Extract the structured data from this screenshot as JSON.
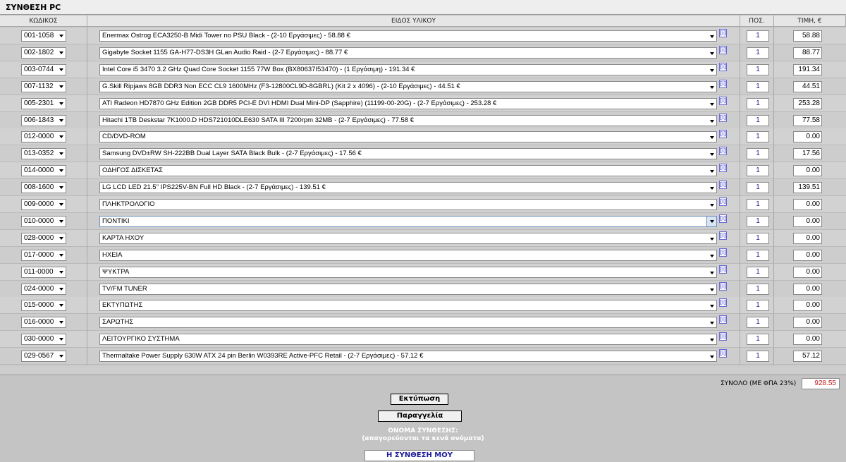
{
  "header": {
    "title": "ΣΥΝΘΕΣΗ PC"
  },
  "columns": {
    "code": "ΚΩΔΙΚΟΣ",
    "description": "ΕΙΔΟΣ ΥΛΙΚΟΥ",
    "qty": "ΠΟΣ.",
    "price": "ΤΙΜΗ, €"
  },
  "info_icon_text": "[i]",
  "rows": [
    {
      "code": "001-1058",
      "description": "Enermax Ostrog ECA3250-B Midi Tower no PSU Black - (2-10 Εργάσιμες) - 58.88 €",
      "qty": "1",
      "price": "58.88"
    },
    {
      "code": "002-1802",
      "description": "Gigabyte Socket 1155 GA-H77-DS3H GLan Audio Raid - (2-7 Εργάσιμες) - 88.77 €",
      "qty": "1",
      "price": "88.77"
    },
    {
      "code": "003-0744",
      "description": "Intel Core i5 3470 3.2 GHz Quad Core Socket 1155 77W Box (BX80637I53470) - (1 Εργάσιμη) - 191.34 €",
      "qty": "1",
      "price": "191.34"
    },
    {
      "code": "007-1132",
      "description": "G.Skill Ripjaws 8GB DDR3 Non ECC CL9 1600MHz (F3-12800CL9D-8GBRL) (Kit 2 x 4096) - (2-10 Εργάσιμες) - 44.51 €",
      "qty": "1",
      "price": "44.51"
    },
    {
      "code": "005-2301",
      "description": "ATI Radeon HD7870 GHz Edition 2GB DDR5 PCI-E DVI HDMI Dual Mini-DP (Sapphire) (11199-00-20G) - (2-7 Εργάσιμες) - 253.28 €",
      "qty": "1",
      "price": "253.28"
    },
    {
      "code": "006-1843",
      "description": "Hitachi 1TB Deskstar 7K1000.D HDS721010DLE630 SATA III 7200rpm 32MB - (2-7 Εργάσιμες) - 77.58 €",
      "qty": "1",
      "price": "77.58"
    },
    {
      "code": "012-0000",
      "description": "CD/DVD-ROM",
      "qty": "1",
      "price": "0.00"
    },
    {
      "code": "013-0352",
      "description": "Samsung DVD±RW SH-222BB Dual Layer SATA Black Bulk - (2-7 Εργάσιμες) - 17.56 €",
      "qty": "1",
      "price": "17.56"
    },
    {
      "code": "014-0000",
      "description": "ΟΔΗΓΟΣ ΔΙΣΚΕΤΑΣ",
      "qty": "1",
      "price": "0.00"
    },
    {
      "code": "008-1600",
      "description": "LG LCD LED 21.5\" IPS225V-BN Full HD Black - (2-7 Εργάσιμες) - 139.51 €",
      "qty": "1",
      "price": "139.51"
    },
    {
      "code": "009-0000",
      "description": "ΠΛΗΚΤΡΟΛΟΓΙΟ",
      "qty": "1",
      "price": "0.00"
    },
    {
      "code": "010-0000",
      "description": "ΠΟΝΤΙΚΙ",
      "qty": "1",
      "price": "0.00",
      "active": true
    },
    {
      "code": "028-0000",
      "description": "ΚΑΡΤΑ ΗΧΟΥ",
      "qty": "1",
      "price": "0.00"
    },
    {
      "code": "017-0000",
      "description": "ΗΧΕΙΑ",
      "qty": "1",
      "price": "0.00"
    },
    {
      "code": "011-0000",
      "description": "ΨΥΚΤΡΑ",
      "qty": "1",
      "price": "0.00"
    },
    {
      "code": "024-0000",
      "description": "TV/FM TUNER",
      "qty": "1",
      "price": "0.00"
    },
    {
      "code": "015-0000",
      "description": "ΕΚΤΥΠΩΤΗΣ",
      "qty": "1",
      "price": "0.00"
    },
    {
      "code": "016-0000",
      "description": "ΣΑΡΩΤΗΣ",
      "qty": "1",
      "price": "0.00"
    },
    {
      "code": "030-0000",
      "description": "ΛΕΙΤΟΥΡΓΙΚΟ ΣΥΣΤΗΜΑ",
      "qty": "1",
      "price": "0.00"
    },
    {
      "code": "029-0567",
      "description": "Thermaltake Power Supply 630W ATX 24 pin Berlin W0393RE Active-PFC Retail - (2-7 Εργάσιμες) - 57.12 €",
      "qty": "1",
      "price": "57.12"
    }
  ],
  "total": {
    "label": "ΣΥΝΟΛΟ (ΜΕ ΦΠΑ 23%)",
    "value": "928.55"
  },
  "buttons": {
    "print": "Εκτύπωση",
    "order": "Παραγγελία"
  },
  "composition_name": {
    "label": "ΟΝΟΜΑ ΣΥΝΘΕΣΗΣ:",
    "hint": "(απαγορεύονται τα κενά ονόματα)",
    "value": "Η ΣΥΝΘΕΣΗ ΜΟΥ"
  },
  "colors": {
    "total_value": "#c01818",
    "qty_text": "#1a1a8a",
    "info_icon": "#2020c8",
    "name_value": "#1a1a9a"
  }
}
